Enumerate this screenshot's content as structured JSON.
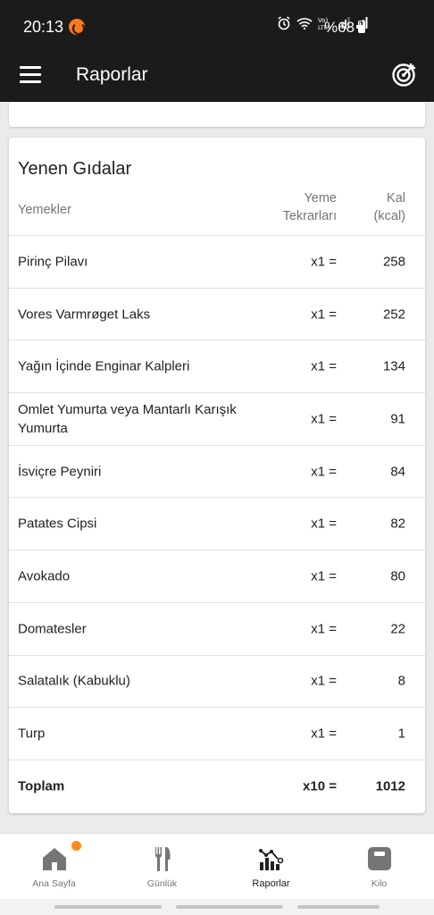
{
  "status_bar": {
    "time": "20:13",
    "battery": "%68"
  },
  "app_bar": {
    "title": "Raporlar"
  },
  "card": {
    "title": "Yenen Gıdalar",
    "headers": {
      "food": "Yemekler",
      "times": "Yeme Tekrarları",
      "kcal": "Kal (kcal)"
    },
    "rows": [
      {
        "food": "Pirinç Pilavı",
        "times": "x1 =",
        "kcal": "258"
      },
      {
        "food": "Vores Varmrøget Laks",
        "times": "x1 =",
        "kcal": "252"
      },
      {
        "food": "Yağın İçinde Enginar Kalpleri",
        "times": "x1 =",
        "kcal": "134"
      },
      {
        "food": "Omlet Yumurta veya Mantarlı Karışık Yumurta",
        "times": "x1 =",
        "kcal": "91"
      },
      {
        "food": "İsviçre Peyniri",
        "times": "x1 =",
        "kcal": "84"
      },
      {
        "food": "Patates Cipsi",
        "times": "x1 =",
        "kcal": "82"
      },
      {
        "food": "Avokado",
        "times": "x1 =",
        "kcal": "80"
      },
      {
        "food": "Domatesler",
        "times": "x1 =",
        "kcal": "22"
      },
      {
        "food": "Salatalık (Kabuklu)",
        "times": "x1 =",
        "kcal": "8"
      },
      {
        "food": "Turp",
        "times": "x1 =",
        "kcal": "1"
      }
    ],
    "total": {
      "food": "Toplam",
      "times": "x10 =",
      "kcal": "1012"
    }
  },
  "bottom_nav": {
    "items": [
      {
        "label": "Ana Sayfa",
        "icon": "home-icon"
      },
      {
        "label": "Günlük",
        "icon": "fork-knife-icon"
      },
      {
        "label": "Raporlar",
        "icon": "chart-icon"
      },
      {
        "label": "Kilo",
        "icon": "scale-icon"
      }
    ],
    "active": "Raporlar"
  },
  "colors": {
    "app_bar": "#1b1b1b",
    "accent": "#ff8c1a",
    "icon_inactive": "#757575"
  }
}
